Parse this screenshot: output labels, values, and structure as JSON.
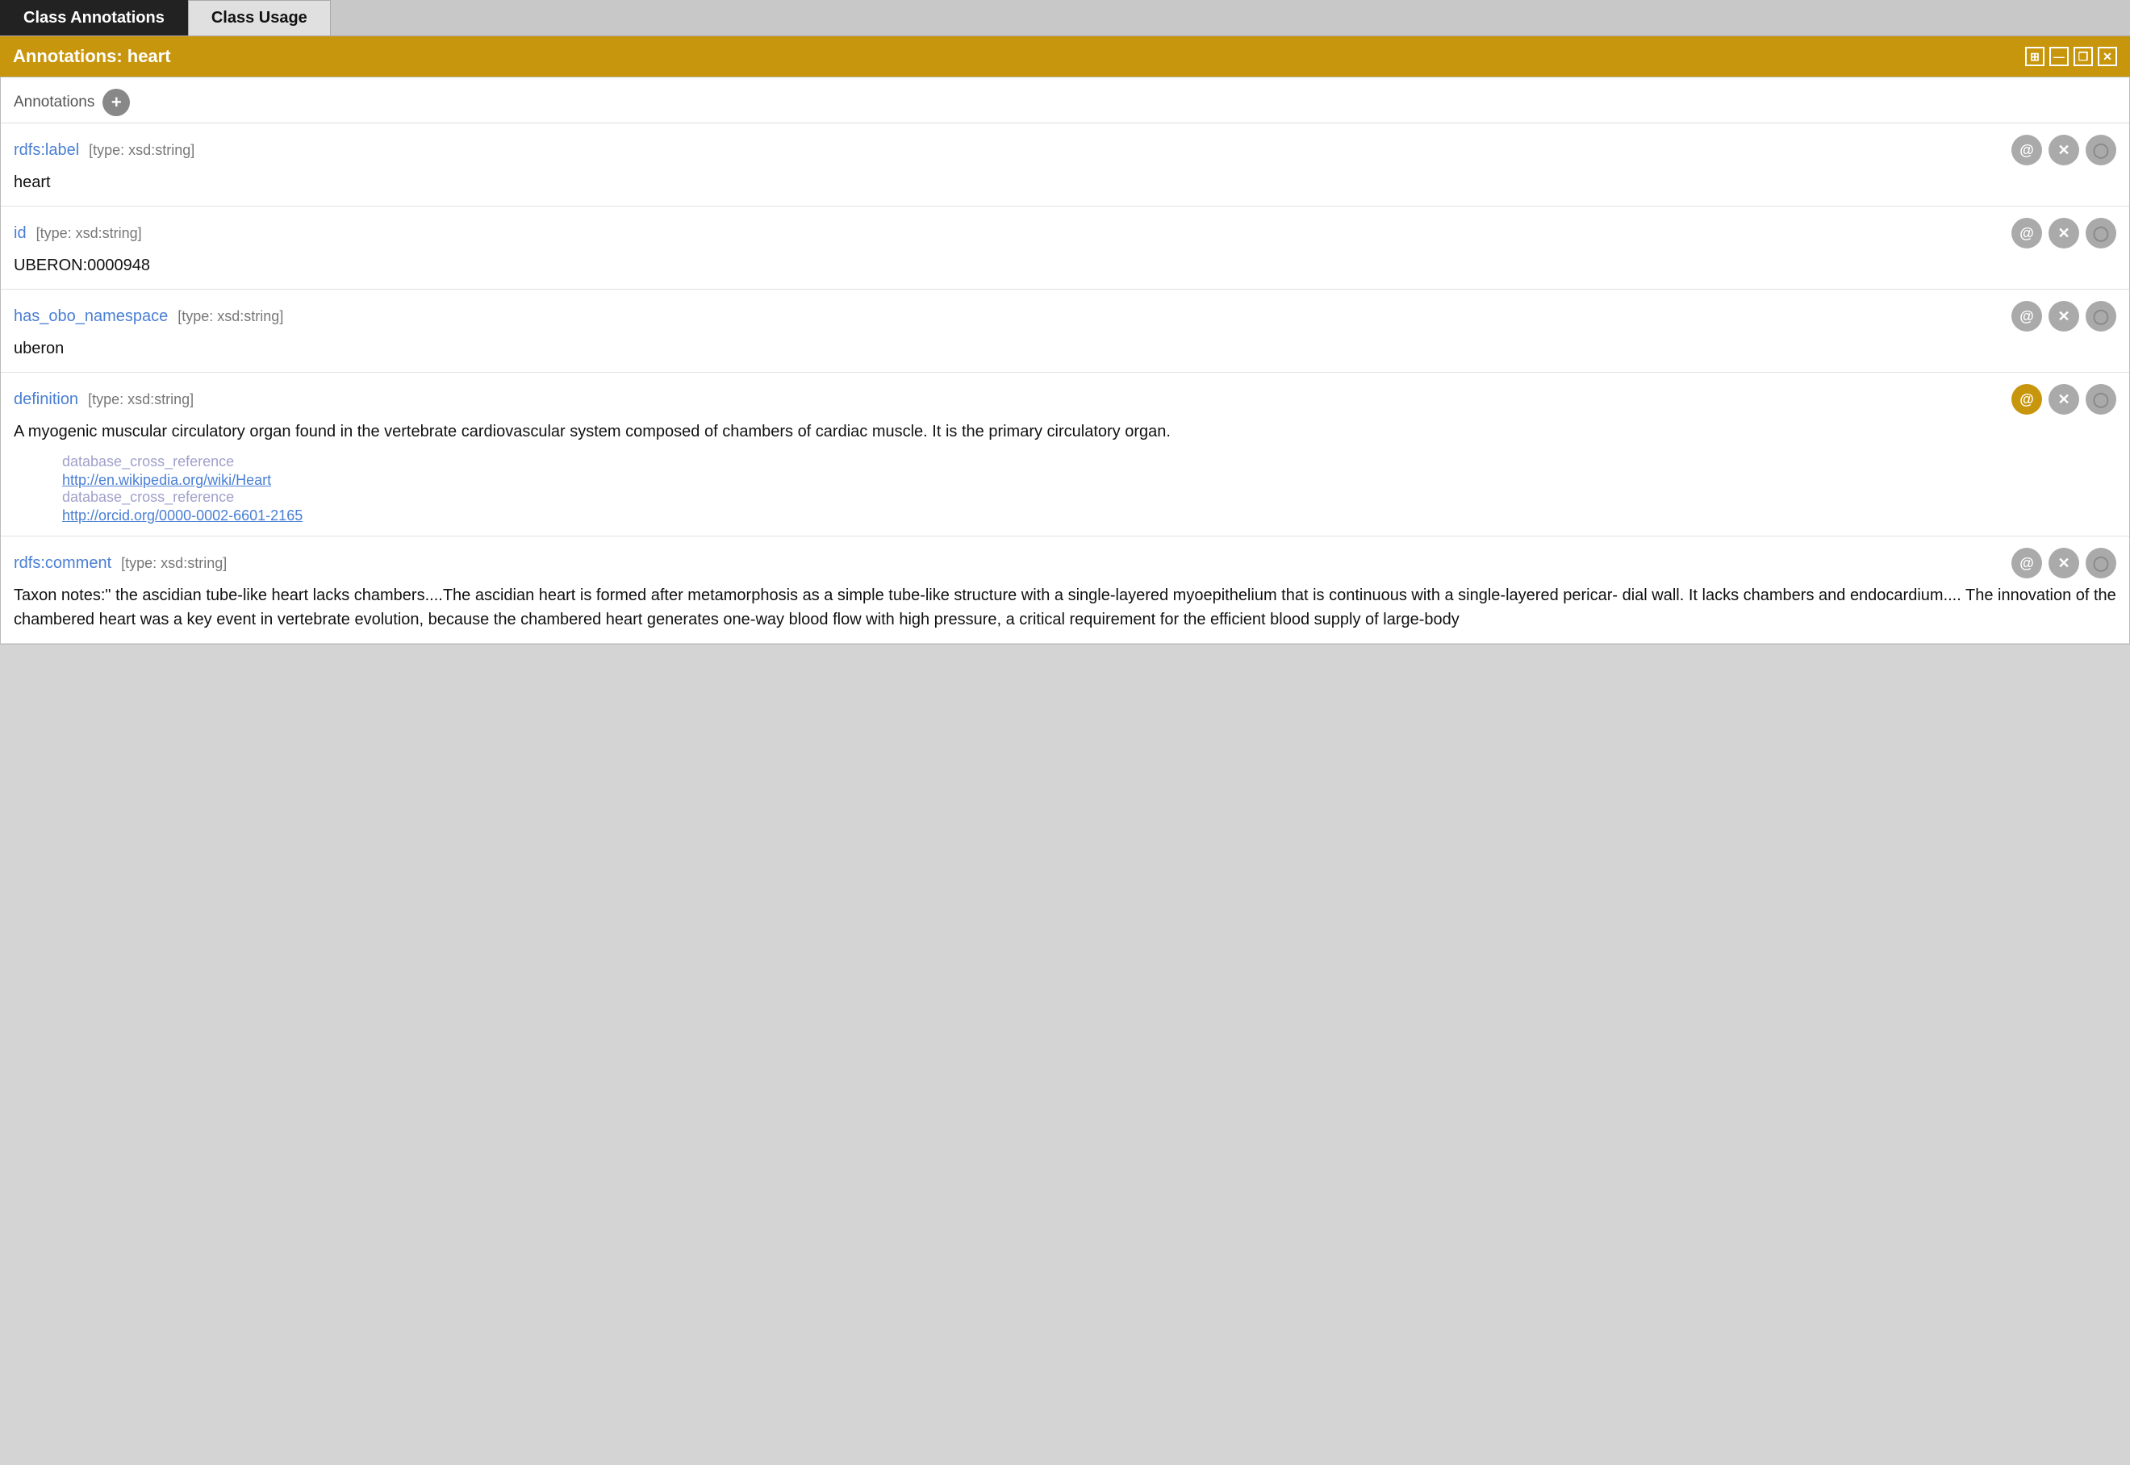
{
  "tabs": [
    {
      "id": "class-annotations",
      "label": "Class Annotations",
      "active": true
    },
    {
      "id": "class-usage",
      "label": "Class Usage",
      "active": false
    }
  ],
  "titleBar": {
    "text": "Annotations: heart",
    "icons": [
      "grid-icon",
      "minus-icon",
      "restore-icon",
      "close-icon"
    ]
  },
  "annotationsHeader": {
    "label": "Annotations",
    "addButtonLabel": "+"
  },
  "annotations": [
    {
      "id": "rdfs-label",
      "property": "rdfs:label",
      "type": "[type: xsd:string]",
      "value": "heart",
      "atActive": false,
      "subItems": []
    },
    {
      "id": "id",
      "property": "id",
      "type": "[type: xsd:string]",
      "value": "UBERON:0000948",
      "atActive": false,
      "subItems": []
    },
    {
      "id": "has-obo-namespace",
      "property": "has_obo_namespace",
      "type": "[type: xsd:string]",
      "value": "uberon",
      "atActive": false,
      "subItems": []
    },
    {
      "id": "definition",
      "property": "definition",
      "type": "[type: xsd:string]",
      "value": "A myogenic muscular circulatory organ found in the vertebrate cardiovascular system composed of chambers of cardiac muscle. It is the primary circulatory organ.",
      "atActive": true,
      "subItems": [
        {
          "label": "database_cross_reference",
          "link": "http://en.wikipedia.org/wiki/Heart"
        },
        {
          "label": "database_cross_reference",
          "link": "http://orcid.org/0000-0002-6601-2165"
        }
      ]
    },
    {
      "id": "rdfs-comment",
      "property": "rdfs:comment",
      "type": "[type: xsd:string]",
      "value": "Taxon notes:\" the ascidian tube-like heart lacks chambers....The ascidian heart is formed after metamorphosis as a simple tube-like structure with a single-layered myoepithelium that is continuous with a single-layered pericar- dial wall. It lacks chambers and endocardium.... The innovation of the chambered heart was a key event in vertebrate evolution, because the chambered heart generates one-way blood flow with high pressure, a critical requirement for the efficient blood supply of large-body",
      "atActive": false,
      "subItems": []
    }
  ],
  "controls": {
    "atLabel": "@",
    "xLabel": "✕",
    "oLabel": "○"
  }
}
